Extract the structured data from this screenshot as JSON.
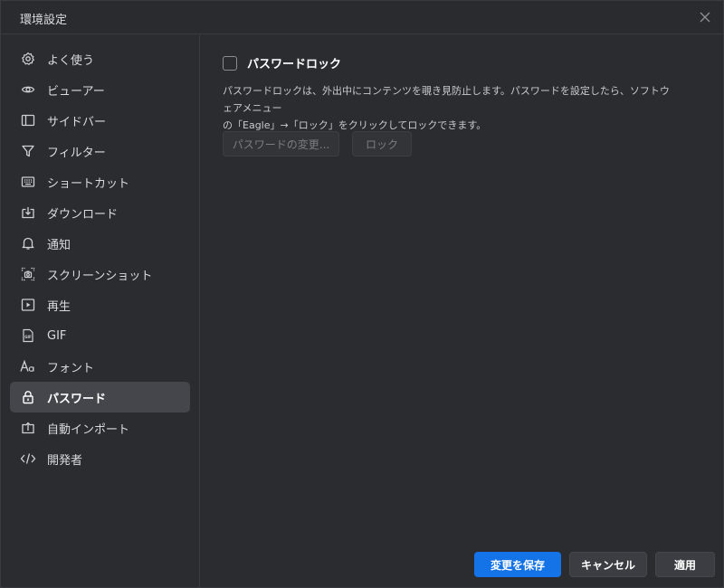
{
  "window": {
    "title": "環境設定"
  },
  "sidebar": {
    "items": [
      {
        "label": "よく使う",
        "icon": "gear-icon"
      },
      {
        "label": "ビューアー",
        "icon": "eye-icon"
      },
      {
        "label": "サイドバー",
        "icon": "sidebar-icon"
      },
      {
        "label": "フィルター",
        "icon": "filter-icon"
      },
      {
        "label": "ショートカット",
        "icon": "keyboard-icon"
      },
      {
        "label": "ダウンロード",
        "icon": "download-icon"
      },
      {
        "label": "通知",
        "icon": "bell-icon"
      },
      {
        "label": "スクリーンショット",
        "icon": "screenshot-icon"
      },
      {
        "label": "再生",
        "icon": "play-icon"
      },
      {
        "label": "GIF",
        "icon": "gif-icon"
      },
      {
        "label": "フォント",
        "icon": "font-icon"
      },
      {
        "label": "パスワード",
        "icon": "lock-icon",
        "active": true
      },
      {
        "label": "自動インポート",
        "icon": "import-icon"
      },
      {
        "label": "開発者",
        "icon": "code-icon"
      }
    ]
  },
  "password": {
    "checkbox_label": "パスワードロック",
    "checked": false,
    "description_line1": "パスワードロックは、外出中にコンテンツを覗き見防止します。パスワードを設定したら、ソフトウェアメニュー",
    "description_line2": "の「Eagle」→「ロック」をクリックしてロックできます。",
    "change_button": "パスワードの変更...",
    "lock_button": "ロック"
  },
  "footer": {
    "save": "変更を保存",
    "cancel": "キャンセル",
    "apply": "適用"
  },
  "colors": {
    "accent": "#1473e6",
    "background": "#2b2c30",
    "active_item": "#45464c"
  }
}
